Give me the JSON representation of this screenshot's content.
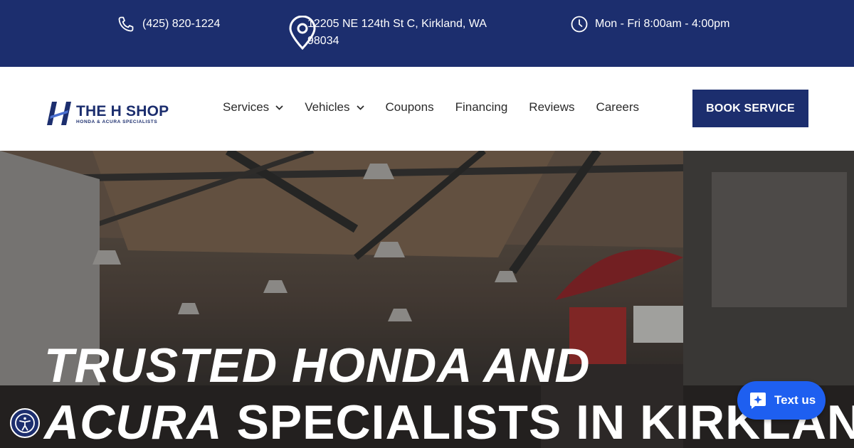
{
  "topbar": {
    "phone": "(425) 820-1224",
    "address": "12205 NE 124th St C, Kirkland, WA 98034",
    "hours": "Mon - Fri 8:00am - 4:00pm"
  },
  "logo": {
    "name": "THE H SHOP",
    "tagline": "HONDA & ACURA SPECIALISTS"
  },
  "nav": {
    "items": [
      {
        "label": "Services"
      },
      {
        "label": "Vehicles"
      },
      {
        "label": "Coupons"
      },
      {
        "label": "Financing"
      },
      {
        "label": "Reviews"
      },
      {
        "label": "Careers"
      }
    ]
  },
  "cta": {
    "book_label": "BOOK SERVICE"
  },
  "hero": {
    "line1": "TRUSTED HONDA AND",
    "line2_italic": "ACURA",
    "line2_rest": " SPECIALISTS IN KIRKLAND,"
  },
  "chat": {
    "label": "Text us"
  },
  "colors": {
    "brand": "#1c2e6e",
    "chat": "#1e5ff0"
  }
}
